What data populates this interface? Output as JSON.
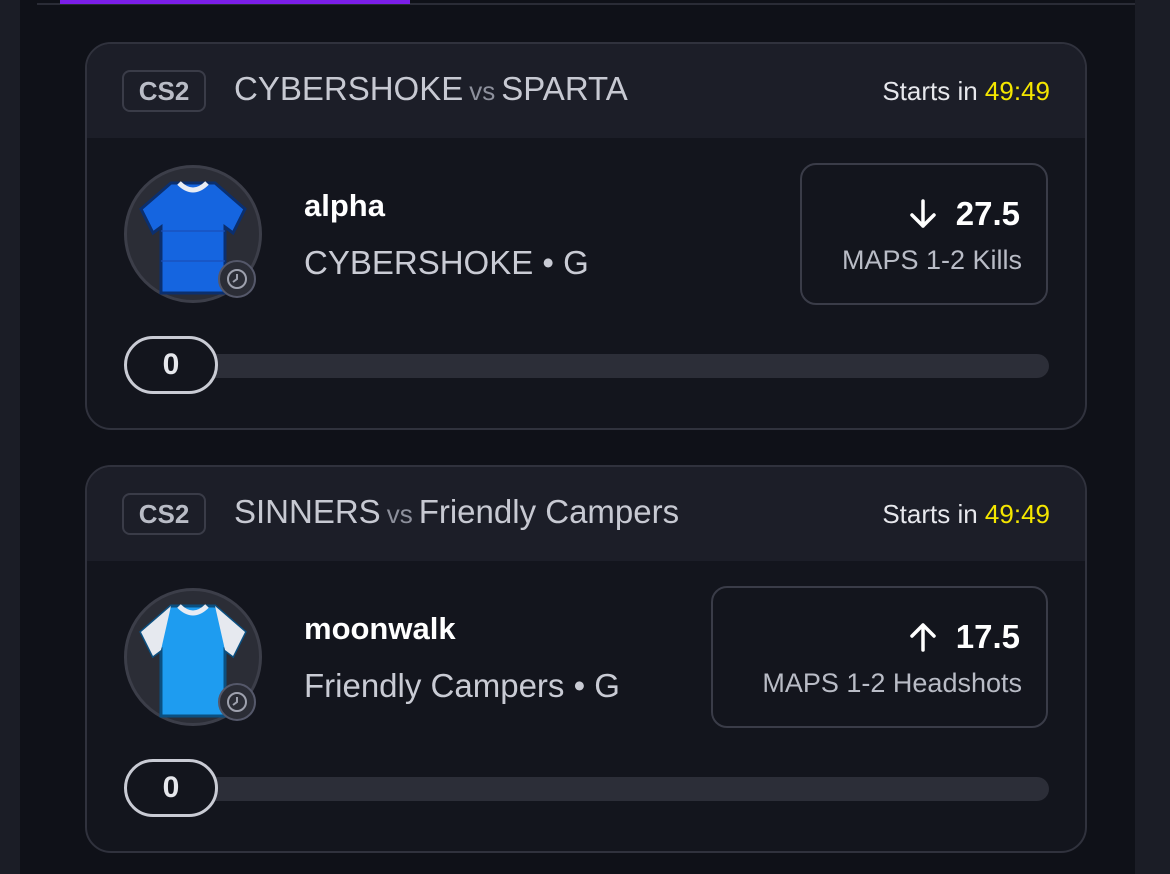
{
  "cards": [
    {
      "game": "CS2",
      "team_a": "CYBERSHOKE",
      "vs": "vs",
      "team_b": "SPARTA",
      "starts_label": "Starts in",
      "starts_time": "49:49",
      "player": "alpha",
      "player_team": "CYBERSHOKE • G",
      "jersey_color": "#1565e0",
      "direction": "down-arrow-icon",
      "line": "27.5",
      "stat": "MAPS 1-2 Kills",
      "progress_value": "0"
    },
    {
      "game": "CS2",
      "team_a": "SINNERS",
      "vs": "vs",
      "team_b": "Friendly Campers",
      "starts_label": "Starts in",
      "starts_time": "49:49",
      "player": "moonwalk",
      "player_team": "Friendly Campers • G",
      "jersey_color": "#1e9cf0",
      "direction": "up-arrow-icon",
      "line": "17.5",
      "stat": "MAPS 1-2 Headshots",
      "progress_value": "0"
    }
  ],
  "colors": {
    "accent": "#7b1ee8",
    "countdown": "#f4e600",
    "background": "#0f1118"
  }
}
